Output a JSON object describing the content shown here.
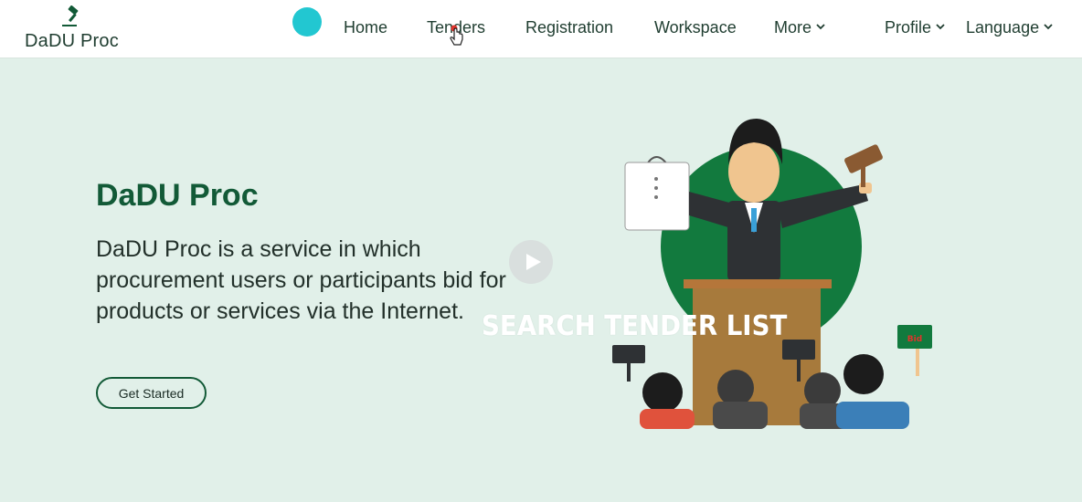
{
  "brand": {
    "name": "DaDU Proc",
    "icon": "gavel-icon",
    "color": "#125a37"
  },
  "accent_color": "#22c7d1",
  "nav": {
    "home": "Home",
    "tenders": "Tenders",
    "registration": "Registration",
    "workspace": "Workspace",
    "more": "More",
    "profile": "Profile",
    "language": "Language"
  },
  "hero": {
    "title": "DaDU Proc",
    "description": "DaDU Proc is a service in which procurement users or participants bid for products or services via the Internet.",
    "cta_label": "Get Started"
  },
  "overlay": {
    "text": "SEARCH TENDER LIST",
    "play_icon": "play-icon"
  },
  "illustration": {
    "sign_text": "Bid"
  }
}
